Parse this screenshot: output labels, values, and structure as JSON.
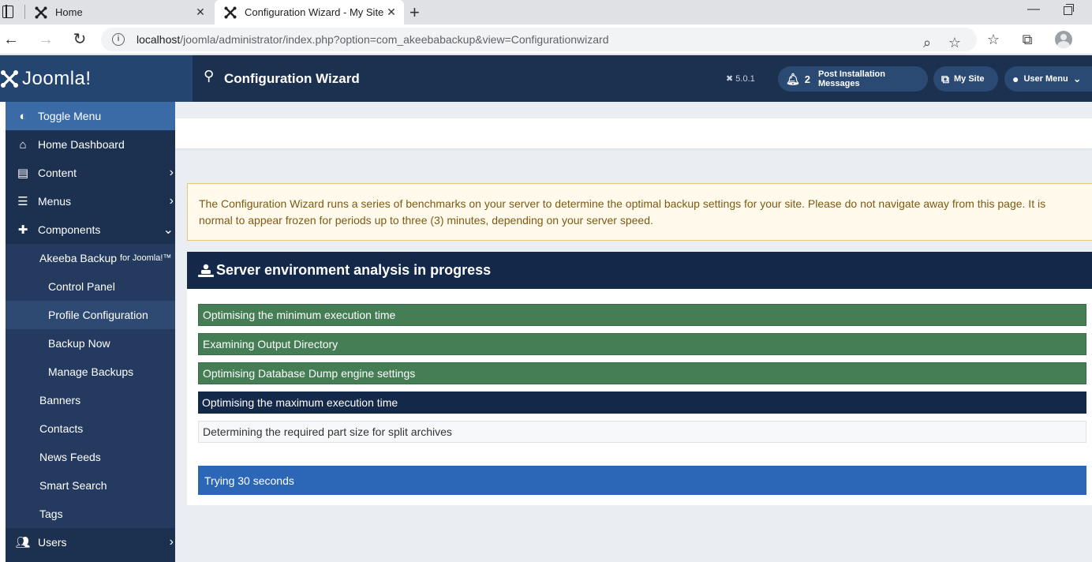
{
  "browser": {
    "tabs": [
      {
        "title": "Home"
      },
      {
        "title": "Configuration Wizard - My Site -"
      }
    ],
    "url_host": "localhost",
    "url_path": "/joomla/administrator/index.php?option=com_akeebabackup&view=Configurationwizard"
  },
  "header": {
    "logo_text": "Joomla!",
    "page_title": "Configuration Wizard",
    "version": "5.0.1",
    "notifications_count": "2",
    "post_install_label": "Post Installation Messages",
    "my_site_label": "My Site",
    "user_menu_label": "User Menu"
  },
  "sidebar": {
    "toggle_label": "Toggle Menu",
    "home_label": "Home Dashboard",
    "content_label": "Content",
    "menus_label": "Menus",
    "components_label": "Components",
    "akeeba_label": "Akeeba Backup",
    "akeeba_suffix": "for Joomla!™",
    "control_panel_label": "Control Panel",
    "profile_config_label": "Profile Configuration",
    "backup_now_label": "Backup Now",
    "manage_backups_label": "Manage Backups",
    "banners_label": "Banners",
    "contacts_label": "Contacts",
    "news_feeds_label": "News Feeds",
    "smart_search_label": "Smart Search",
    "tags_label": "Tags",
    "users_label": "Users"
  },
  "main": {
    "warning_text": "The Configuration Wizard runs a series of benchmarks on your server to determine the optimal backup settings for your site. Please do not navigate away from this page. It is normal to appear frozen for periods up to three (3) minutes, depending on your server speed.",
    "card_title": "Server environment analysis in progress",
    "steps": [
      {
        "label": "Optimising the minimum execution time",
        "state": "done"
      },
      {
        "label": "Examining Output Directory",
        "state": "done"
      },
      {
        "label": "Optimising Database Dump engine settings",
        "state": "done"
      },
      {
        "label": "Optimising the maximum execution time",
        "state": "current"
      },
      {
        "label": "Determining the required part size for split archives",
        "state": "pending"
      }
    ],
    "status_text": "Trying 30 seconds"
  },
  "colors": {
    "header_bg": "#1c3150",
    "done_green": "#457d54",
    "current_navy": "#14294a",
    "status_blue": "#2b67b6",
    "warning_bg": "#fffaeb"
  }
}
